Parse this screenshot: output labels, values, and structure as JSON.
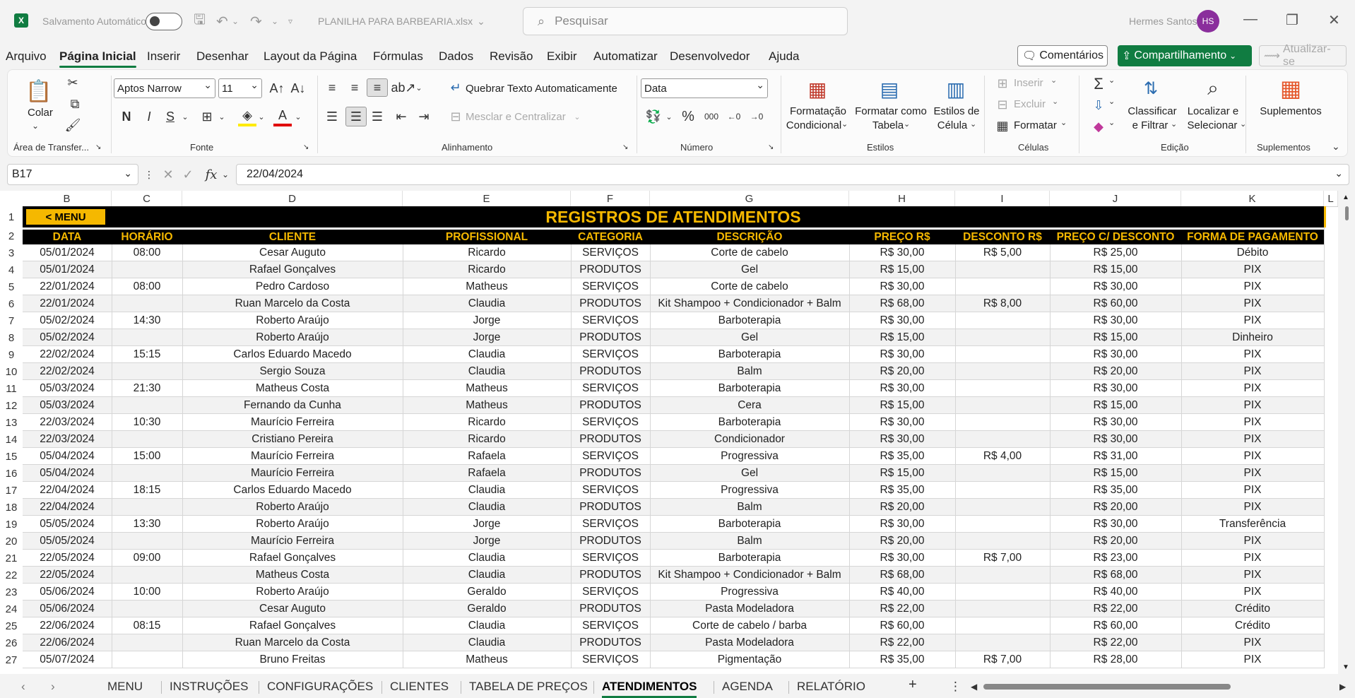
{
  "titlebar": {
    "autosave_label": "Salvamento Automático",
    "filename": "PLANILHA PARA BARBEARIA.xlsx",
    "search_placeholder": "Pesquisar",
    "user_name": "Hermes Santos",
    "user_initials": "HS"
  },
  "menu": {
    "items": [
      "Arquivo",
      "Página Inicial",
      "Inserir",
      "Desenhar",
      "Layout da Página",
      "Fórmulas",
      "Dados",
      "Revisão",
      "Exibir",
      "Automatizar",
      "Desenvolvedor",
      "Ajuda"
    ],
    "active": "Página Inicial",
    "comments": "Comentários",
    "share": "Compartilhamento",
    "update": "Atualizar-se"
  },
  "ribbon": {
    "clipboard": {
      "label": "Área de Transfer...",
      "paste": "Colar"
    },
    "font": {
      "label": "Fonte",
      "family": "Aptos Narrow",
      "size": "11",
      "bold": "N",
      "italic": "I",
      "underline": "S"
    },
    "alignment": {
      "label": "Alinhamento",
      "wrap": "Quebrar Texto Automaticamente",
      "merge": "Mesclar e Centralizar"
    },
    "number": {
      "label": "Número",
      "format": "Data",
      "percent": "%",
      "thousands": "000"
    },
    "styles": {
      "label": "Estilos",
      "conditional_1": "Formatação",
      "conditional_2": "Condicional",
      "table_1": "Formatar como",
      "table_2": "Tabela",
      "cell_1": "Estilos de",
      "cell_2": "Célula"
    },
    "cells": {
      "label": "Células",
      "insert": "Inserir",
      "delete": "Excluir",
      "format": "Formatar"
    },
    "editing": {
      "label": "Edição",
      "sort_1": "Classificar",
      "sort_2": "e Filtrar",
      "find_1": "Localizar e",
      "find_2": "Selecionar"
    },
    "addins": {
      "label": "Suplementos",
      "addins": "Suplementos"
    }
  },
  "formula_bar": {
    "cell_ref": "B17",
    "value": "22/04/2024",
    "fx": "fx"
  },
  "columns": [
    "B",
    "C",
    "D",
    "E",
    "F",
    "G",
    "H",
    "I",
    "J",
    "K",
    "L"
  ],
  "sheet": {
    "menu_button": "< MENU",
    "title": "REGISTROS DE ATENDIMENTOS",
    "headers": [
      "DATA",
      "HORÁRIO",
      "CLIENTE",
      "PROFISSIONAL",
      "CATEGORIA",
      "DESCRIÇÃO",
      "PREÇO R$",
      "DESCONTO R$",
      "PREÇO C/ DESCONTO",
      "FORMA DE PAGAMENTO"
    ],
    "rows": [
      [
        "05/01/2024",
        "08:00",
        "Cesar Auguto",
        "Ricardo",
        "SERVIÇOS",
        "Corte de cabelo",
        "R$ 30,00",
        "R$ 5,00",
        "R$ 25,00",
        "Débito"
      ],
      [
        "05/01/2024",
        "",
        "Rafael Gonçalves",
        "Ricardo",
        "PRODUTOS",
        "Gel",
        "R$ 15,00",
        "",
        "R$ 15,00",
        "PIX"
      ],
      [
        "22/01/2024",
        "08:00",
        "Pedro Cardoso",
        "Matheus",
        "SERVIÇOS",
        "Corte de cabelo",
        "R$ 30,00",
        "",
        "R$ 30,00",
        "PIX"
      ],
      [
        "22/01/2024",
        "",
        "Ruan Marcelo da Costa",
        "Claudia",
        "PRODUTOS",
        "Kit Shampoo + Condicionador + Balm",
        "R$ 68,00",
        "R$ 8,00",
        "R$ 60,00",
        "PIX"
      ],
      [
        "05/02/2024",
        "14:30",
        "Roberto Araújo",
        "Jorge",
        "SERVIÇOS",
        "Barboterapia",
        "R$ 30,00",
        "",
        "R$ 30,00",
        "PIX"
      ],
      [
        "05/02/2024",
        "",
        "Roberto Araújo",
        "Jorge",
        "PRODUTOS",
        "Gel",
        "R$ 15,00",
        "",
        "R$ 15,00",
        "Dinheiro"
      ],
      [
        "22/02/2024",
        "15:15",
        "Carlos Eduardo Macedo",
        "Claudia",
        "SERVIÇOS",
        "Barboterapia",
        "R$ 30,00",
        "",
        "R$ 30,00",
        "PIX"
      ],
      [
        "22/02/2024",
        "",
        "Sergio Souza",
        "Claudia",
        "PRODUTOS",
        "Balm",
        "R$ 20,00",
        "",
        "R$ 20,00",
        "PIX"
      ],
      [
        "05/03/2024",
        "21:30",
        "Matheus Costa",
        "Matheus",
        "SERVIÇOS",
        "Barboterapia",
        "R$ 30,00",
        "",
        "R$ 30,00",
        "PIX"
      ],
      [
        "05/03/2024",
        "",
        "Fernando da Cunha",
        "Matheus",
        "PRODUTOS",
        "Cera",
        "R$ 15,00",
        "",
        "R$ 15,00",
        "PIX"
      ],
      [
        "22/03/2024",
        "10:30",
        "Maurício Ferreira",
        "Ricardo",
        "SERVIÇOS",
        "Barboterapia",
        "R$ 30,00",
        "",
        "R$ 30,00",
        "PIX"
      ],
      [
        "22/03/2024",
        "",
        "Cristiano Pereira",
        "Ricardo",
        "PRODUTOS",
        "Condicionador",
        "R$ 30,00",
        "",
        "R$ 30,00",
        "PIX"
      ],
      [
        "05/04/2024",
        "15:00",
        "Maurício Ferreira",
        "Rafaela",
        "SERVIÇOS",
        "Progressiva",
        "R$ 35,00",
        "R$ 4,00",
        "R$ 31,00",
        "PIX"
      ],
      [
        "05/04/2024",
        "",
        "Maurício Ferreira",
        "Rafaela",
        "PRODUTOS",
        "Gel",
        "R$ 15,00",
        "",
        "R$ 15,00",
        "PIX"
      ],
      [
        "22/04/2024",
        "18:15",
        "Carlos Eduardo Macedo",
        "Claudia",
        "SERVIÇOS",
        "Progressiva",
        "R$ 35,00",
        "",
        "R$ 35,00",
        "PIX"
      ],
      [
        "22/04/2024",
        "",
        "Roberto Araújo",
        "Claudia",
        "PRODUTOS",
        "Balm",
        "R$ 20,00",
        "",
        "R$ 20,00",
        "PIX"
      ],
      [
        "05/05/2024",
        "13:30",
        "Roberto Araújo",
        "Jorge",
        "SERVIÇOS",
        "Barboterapia",
        "R$ 30,00",
        "",
        "R$ 30,00",
        "Transferência"
      ],
      [
        "05/05/2024",
        "",
        "Maurício Ferreira",
        "Jorge",
        "PRODUTOS",
        "Balm",
        "R$ 20,00",
        "",
        "R$ 20,00",
        "PIX"
      ],
      [
        "22/05/2024",
        "09:00",
        "Rafael Gonçalves",
        "Claudia",
        "SERVIÇOS",
        "Barboterapia",
        "R$ 30,00",
        "R$ 7,00",
        "R$ 23,00",
        "PIX"
      ],
      [
        "22/05/2024",
        "",
        "Matheus Costa",
        "Claudia",
        "PRODUTOS",
        "Kit Shampoo + Condicionador + Balm",
        "R$ 68,00",
        "",
        "R$ 68,00",
        "PIX"
      ],
      [
        "05/06/2024",
        "10:00",
        "Roberto Araújo",
        "Geraldo",
        "SERVIÇOS",
        "Progressiva",
        "R$ 40,00",
        "",
        "R$ 40,00",
        "PIX"
      ],
      [
        "05/06/2024",
        "",
        "Cesar Auguto",
        "Geraldo",
        "PRODUTOS",
        "Pasta Modeladora",
        "R$ 22,00",
        "",
        "R$ 22,00",
        "Crédito"
      ],
      [
        "22/06/2024",
        "08:15",
        "Rafael Gonçalves",
        "Claudia",
        "SERVIÇOS",
        "Corte de cabelo / barba",
        "R$ 60,00",
        "",
        "R$ 60,00",
        "Crédito"
      ],
      [
        "22/06/2024",
        "",
        "Ruan Marcelo da Costa",
        "Claudia",
        "PRODUTOS",
        "Pasta Modeladora",
        "R$ 22,00",
        "",
        "R$ 22,00",
        "PIX"
      ],
      [
        "05/07/2024",
        "",
        "Bruno Freitas",
        "Matheus",
        "SERVIÇOS",
        "Pigmentação",
        "R$ 35,00",
        "R$ 7,00",
        "R$ 28,00",
        "PIX"
      ]
    ]
  },
  "tabs": [
    "MENU",
    "INSTRUÇÕES",
    "CONFIGURAÇÕES",
    "CLIENTES",
    "TABELA DE PREÇOS",
    "ATENDIMENTOS",
    "AGENDA",
    "RELATÓRIO"
  ],
  "active_tab": "ATENDIMENTOS",
  "colors": {
    "accent": "#107c41",
    "header_bg": "#000000",
    "header_text": "#f5b800",
    "stripe": "#f2f2f2"
  }
}
